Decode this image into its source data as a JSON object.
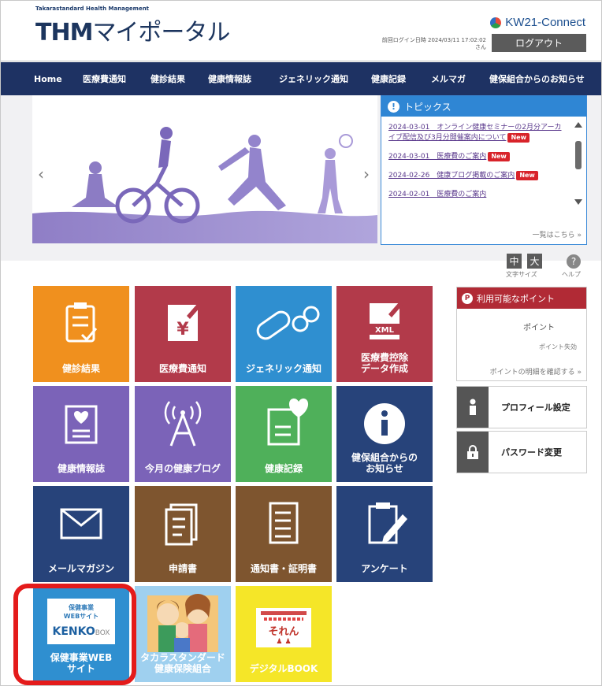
{
  "header": {
    "company": "Takarastandard Health Management",
    "logo_bold": "THM",
    "logo_rest": "マイポータル",
    "brand": "KW21-Connect",
    "last_login_label": "前回ログイン日時 2024/03/11 17:02:02",
    "user_suffix": "さん",
    "logout_label": "ログアウト"
  },
  "nav": {
    "items": [
      "Home",
      "医療費通知",
      "健診結果",
      "健康情報誌",
      "ジェネリック通知",
      "健康記録",
      "メルマガ",
      "健保組合からのお知らせ"
    ]
  },
  "banner": {
    "prev": "‹",
    "next": "›"
  },
  "topics": {
    "title": "トピックス",
    "items": [
      {
        "text": "2024-03-01　オンライン健康セミナーの2月分アーカイブ配信及び3月分開催案内について",
        "new": "New"
      },
      {
        "text": "2024-03-01　医療費のご案内",
        "new": "New"
      },
      {
        "text": "2024-02-26　健康ブログ掲載のご案内",
        "new": "New"
      },
      {
        "text": "2024-02-01　医療費のご案内",
        "new": ""
      }
    ],
    "more": "一覧はこちら »"
  },
  "tools": {
    "medium": "中",
    "large": "大",
    "font_size_label": "文字サイズ",
    "help_label": "ヘルプ",
    "help_glyph": "?"
  },
  "tiles": [
    {
      "label": "健診結果",
      "color": "#f0901e"
    },
    {
      "label": "医療費通知",
      "color": "#b23a4a"
    },
    {
      "label": "ジェネリック通知",
      "color": "#2f8fd0"
    },
    {
      "label": "医療費控除データ作成",
      "line1": "医療費控除",
      "line2": "データ作成",
      "color": "#b23a4a"
    },
    {
      "label": "健康情報誌",
      "color": "#7b63b8"
    },
    {
      "label": "今月の健康ブログ",
      "color": "#7b63b8"
    },
    {
      "label": "健康記録",
      "color": "#4fb05a"
    },
    {
      "label": "健保組合からのお知らせ",
      "line1": "健保組合からの",
      "line2": "お知らせ",
      "color": "#27437a"
    },
    {
      "label": "メールマガジン",
      "color": "#27437a"
    },
    {
      "label": "申請書",
      "color": "#7e552f"
    },
    {
      "label": "通知書・証明書",
      "color": "#7e552f"
    },
    {
      "label": "アンケート",
      "color": "#27437a"
    },
    {
      "label": "保健事業WEBサイト",
      "line1": "保健事業WEB",
      "line2": "サイト",
      "color": "#2f8fd0",
      "inner_line1": "保健事業",
      "inner_line2": "WEBサイト",
      "inner_logo": "KENKO",
      "inner_logo_suffix": "BOX"
    },
    {
      "label": "タカラスタンダード健康保険組合",
      "line1": "タカラスタンダード",
      "line2": "健康保険組合",
      "color": "#9fd0ef"
    },
    {
      "label": "デジタルBOOK",
      "color": "#f5e628",
      "inner_title": "それん"
    }
  ],
  "points": {
    "title": "利用可能なポイント",
    "point_label": "ポイント",
    "expiry_label": "ポイント失効",
    "detail_link": "ポイントの明細を確認する »"
  },
  "side_buttons": [
    {
      "label": "プロフィール設定"
    },
    {
      "label": "パスワード変更"
    }
  ]
}
